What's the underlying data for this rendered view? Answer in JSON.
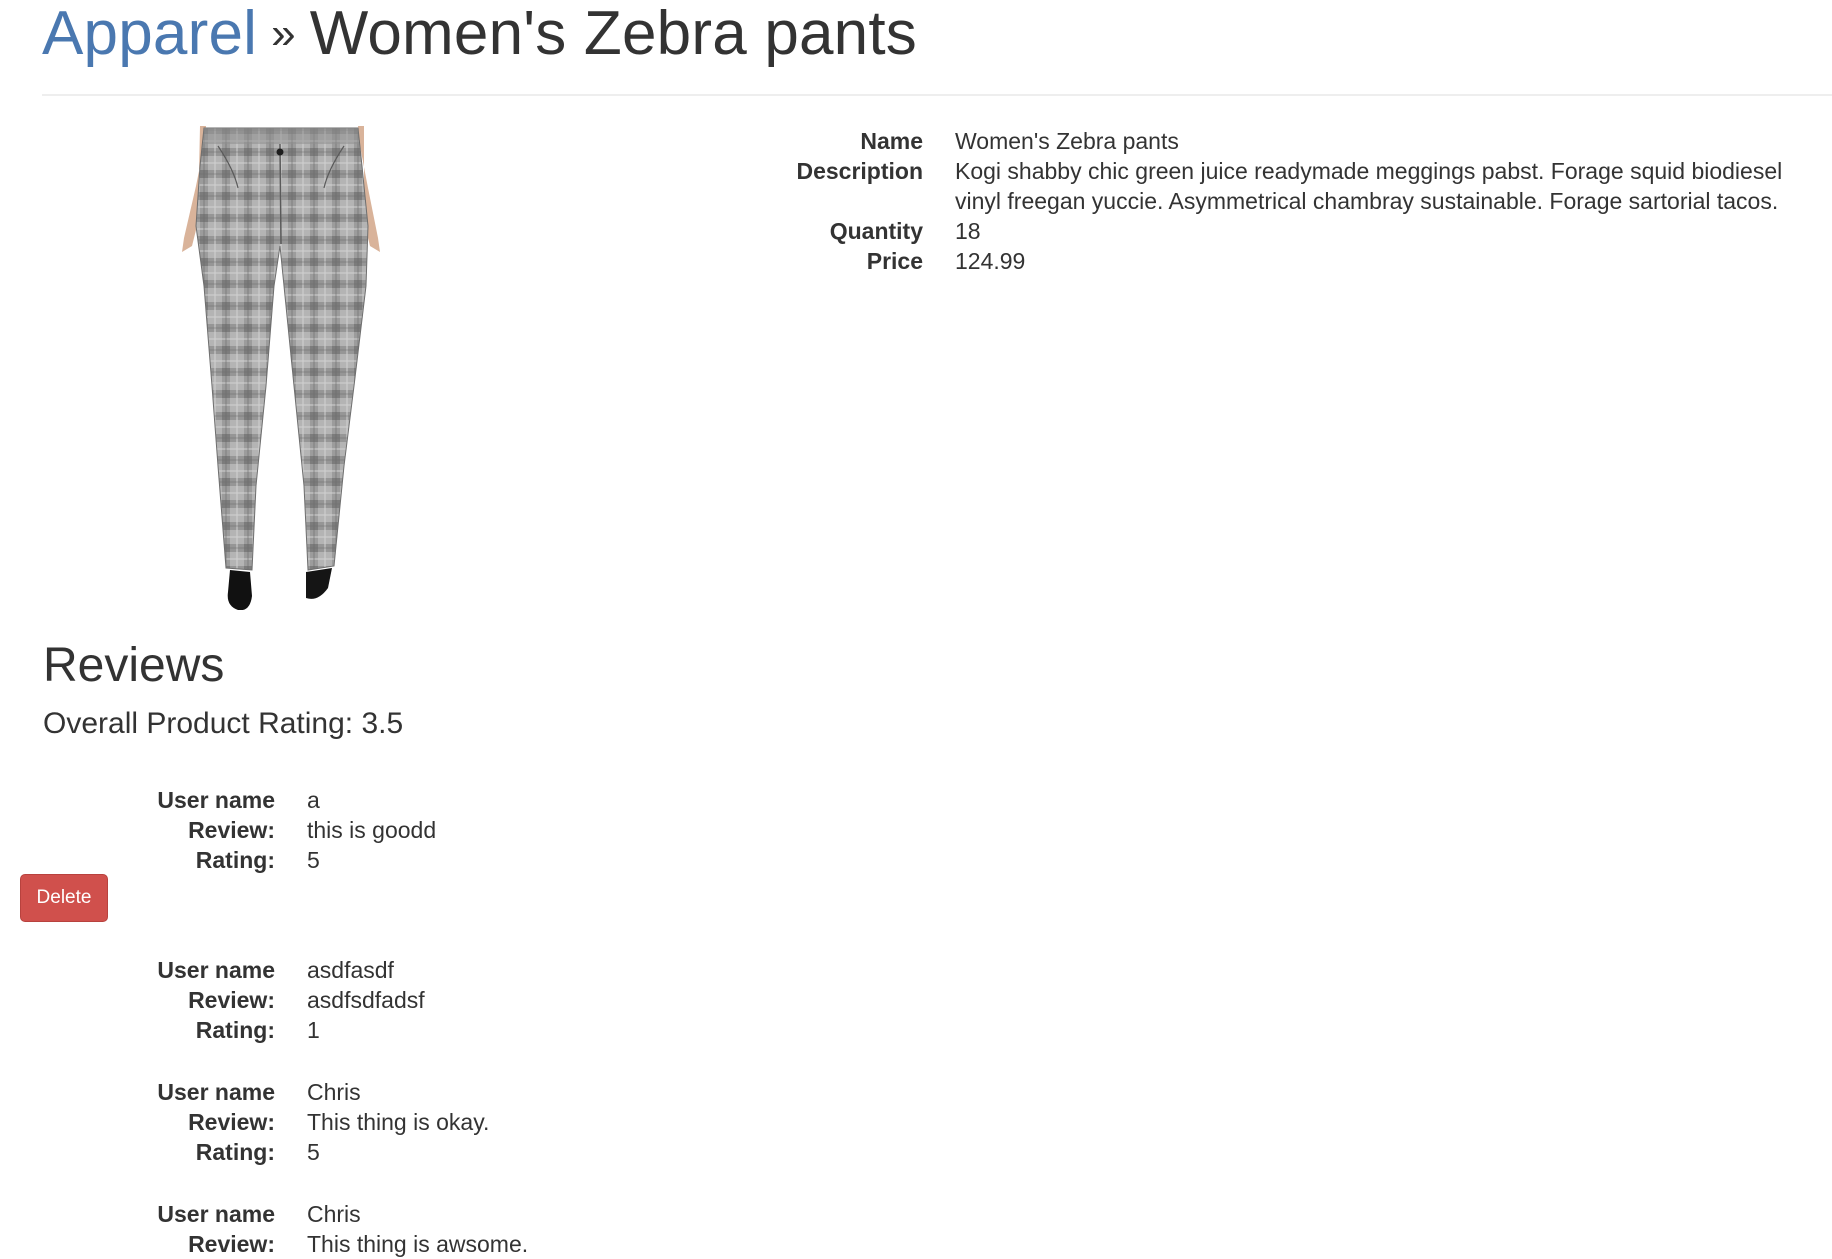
{
  "header": {
    "category_link": "Apparel",
    "separator": "»",
    "product_title": "Women's Zebra pants"
  },
  "product": {
    "image_icon": "plaid-pants-photo",
    "details": [
      {
        "label": "Name",
        "value": "Women's Zebra pants"
      },
      {
        "label": "Description",
        "value": "Kogi shabby chic green juice readymade meggings pabst. Forage squid biodiesel vinyl freegan yuccie. Asymmetrical chambray sustainable. Forage sartorial tacos."
      },
      {
        "label": "Quantity",
        "value": "18"
      },
      {
        "label": "Price",
        "value": "124.99"
      }
    ]
  },
  "reviews": {
    "heading": "Reviews",
    "overall_label": "Overall Product Rating: 3.5",
    "labels": {
      "user": "User name",
      "review": "Review:",
      "rating": "Rating:"
    },
    "delete_label": "Delete",
    "items": [
      {
        "user": "a",
        "review": "this is goodd",
        "rating": "5"
      },
      {
        "user": "asdfasdf",
        "review": "asdfsdfadsf",
        "rating": "1"
      },
      {
        "user": "Chris",
        "review": "This thing is okay.",
        "rating": "5"
      },
      {
        "user": "Chris",
        "review": "This thing is awsome."
      }
    ]
  },
  "colors": {
    "link": "#4a78b0",
    "danger": "#d0504c",
    "text": "#333333"
  }
}
